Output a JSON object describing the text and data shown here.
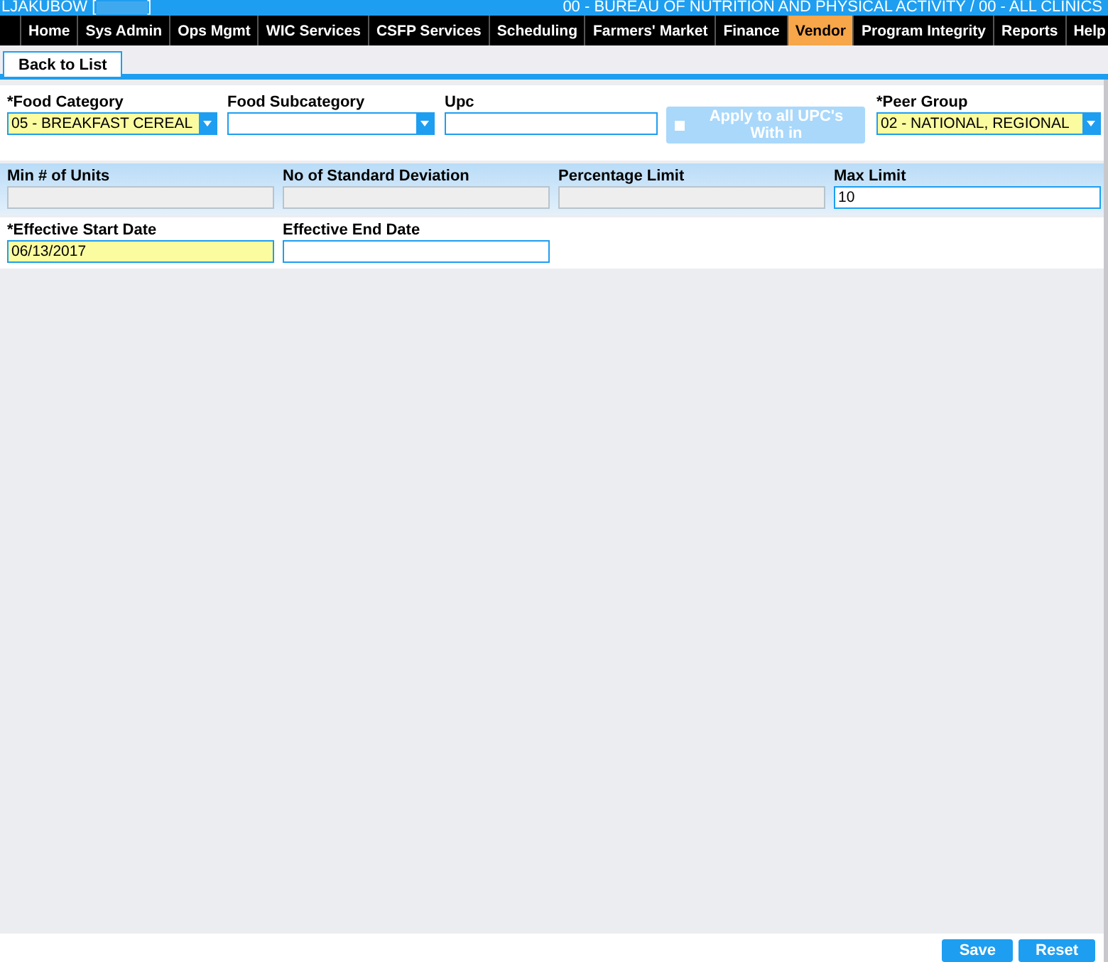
{
  "header": {
    "user": "LJAKUBOW [",
    "user_end": "]",
    "context": "00 - BUREAU OF NUTRITION AND PHYSICAL ACTIVITY / 00 - ALL CLINICS"
  },
  "nav": [
    {
      "label": "Home",
      "selected": false
    },
    {
      "label": "Sys Admin",
      "selected": false
    },
    {
      "label": "Ops Mgmt",
      "selected": false
    },
    {
      "label": "WIC Services",
      "selected": false
    },
    {
      "label": "CSFP Services",
      "selected": false
    },
    {
      "label": "Scheduling",
      "selected": false
    },
    {
      "label": "Farmers' Market",
      "selected": false
    },
    {
      "label": "Finance",
      "selected": false
    },
    {
      "label": "Vendor",
      "selected": true
    },
    {
      "label": "Program Integrity",
      "selected": false
    },
    {
      "label": "Reports",
      "selected": false
    },
    {
      "label": "Help",
      "selected": false
    }
  ],
  "back_tab": "Back to List",
  "rows": [
    {
      "band": false,
      "fields": [
        {
          "kind": "select",
          "label": "*Food Category",
          "value": "05 - BREAKFAST CEREAL",
          "required": true,
          "disabled": false
        },
        {
          "kind": "select",
          "label": "Food Subcategory",
          "required": false,
          "disabled": false
        },
        {
          "kind": "text",
          "label": "Upc",
          "required": false,
          "disabled": false
        },
        {
          "kind": "apply",
          "label": "Apply to all UPC's With in",
          "checked": false,
          "disabled": true
        },
        {
          "kind": "select",
          "label": "*Peer Group",
          "value": "02 - NATIONAL, REGIONAL",
          "required": true,
          "disabled": false
        }
      ]
    },
    {
      "band": true,
      "fields": [
        {
          "kind": "text",
          "label": "Min # of Units",
          "required": false,
          "disabled": true
        },
        {
          "kind": "text",
          "label": "No of Standard Deviation",
          "required": false,
          "disabled": true
        },
        {
          "kind": "text",
          "label": "Percentage Limit",
          "required": false,
          "disabled": true
        },
        {
          "kind": "text",
          "label": "Max Limit",
          "value": "10",
          "required": false,
          "disabled": false
        }
      ]
    },
    {
      "band": false,
      "fields": [
        {
          "kind": "text",
          "label": "*Effective Start Date",
          "value": "06/13/2017",
          "required": true,
          "disabled": false
        },
        {
          "kind": "text",
          "label": "Effective End Date",
          "required": false,
          "disabled": false
        }
      ]
    }
  ],
  "buttons": [
    "Save",
    "Reset"
  ]
}
